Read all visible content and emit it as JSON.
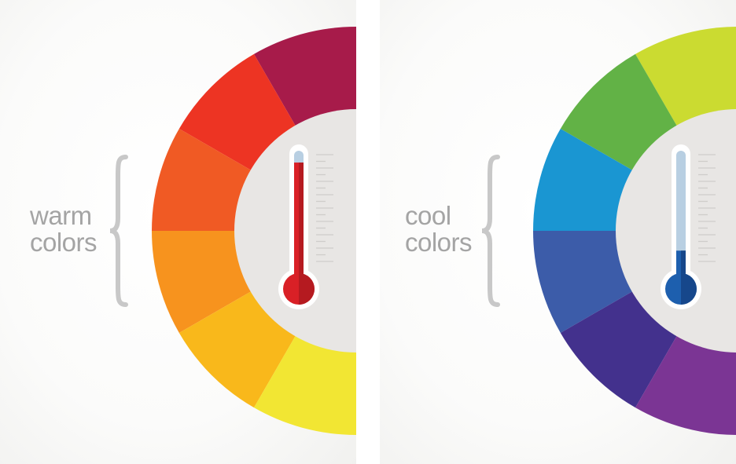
{
  "panels": [
    {
      "id": "warm",
      "label_line1": "warm",
      "label_line2": "colors",
      "segment_colors": [
        "#a71b4a",
        "#ed3423",
        "#f05a24",
        "#f7931e",
        "#f9b81b",
        "#f2e633"
      ],
      "thermometer": {
        "level": 0.93,
        "fill_color": "#d92026",
        "fill_shade": "#b51a20"
      }
    },
    {
      "id": "cool",
      "label_line1": "cool",
      "label_line2": "colors",
      "segment_colors": [
        "#cbdb31",
        "#62b246",
        "#1a96d2",
        "#3c5ca9",
        "#43318d",
        "#7b3594"
      ],
      "thermometer": {
        "level": 0.22,
        "fill_color": "#1d5fae",
        "fill_shade": "#16478b"
      }
    }
  ],
  "colors": {
    "label": "#a4a4a4",
    "brace": "#c8c8c8",
    "wheel_center": "#e8e6e4",
    "thermo_tube_empty": "#b8cfe2",
    "thermo_outline": "#ffffff",
    "scale_ticks": "#cfcdca"
  }
}
